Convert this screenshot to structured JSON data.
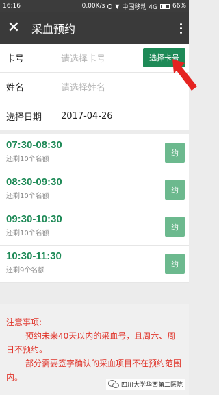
{
  "status_bar": {
    "time": "16:16",
    "speed": "0.00K/s",
    "carrier": "中国移动 4G",
    "battery": "66%",
    "battery_level": 0.66
  },
  "app_bar": {
    "close_icon": "close-icon",
    "title": "采血预约",
    "more_icon": "more-vertical-icon"
  },
  "form": {
    "card": {
      "label": "卡号",
      "placeholder": "请选择卡号",
      "button": "选择卡号"
    },
    "name": {
      "label": "姓名",
      "placeholder": "请选择姓名"
    },
    "date": {
      "label": "选择日期",
      "value": "2017-04-26"
    }
  },
  "slots": [
    {
      "time": "07:30-08:30",
      "remain": "还剩10个名额",
      "button": "约"
    },
    {
      "time": "08:30-09:30",
      "remain": "还剩10个名额",
      "button": "约"
    },
    {
      "time": "09:30-10:30",
      "remain": "还剩10个名额",
      "button": "约"
    },
    {
      "time": "10:30-11:30",
      "remain": "还剩9个名额",
      "button": "约"
    }
  ],
  "notice": {
    "title": "注意事项:",
    "line1": "预约未来40天以内的采血号，且周六、周日不预约。",
    "line2": "部分需要签字确认的采血项目不在预约范围内。"
  },
  "watermark": {
    "text": "四川大学华西第二医院"
  },
  "colors": {
    "accent": "#1e8a57",
    "book_button": "#6cb98e",
    "notice_text": "#e0352b",
    "arrow": "#e52320"
  }
}
